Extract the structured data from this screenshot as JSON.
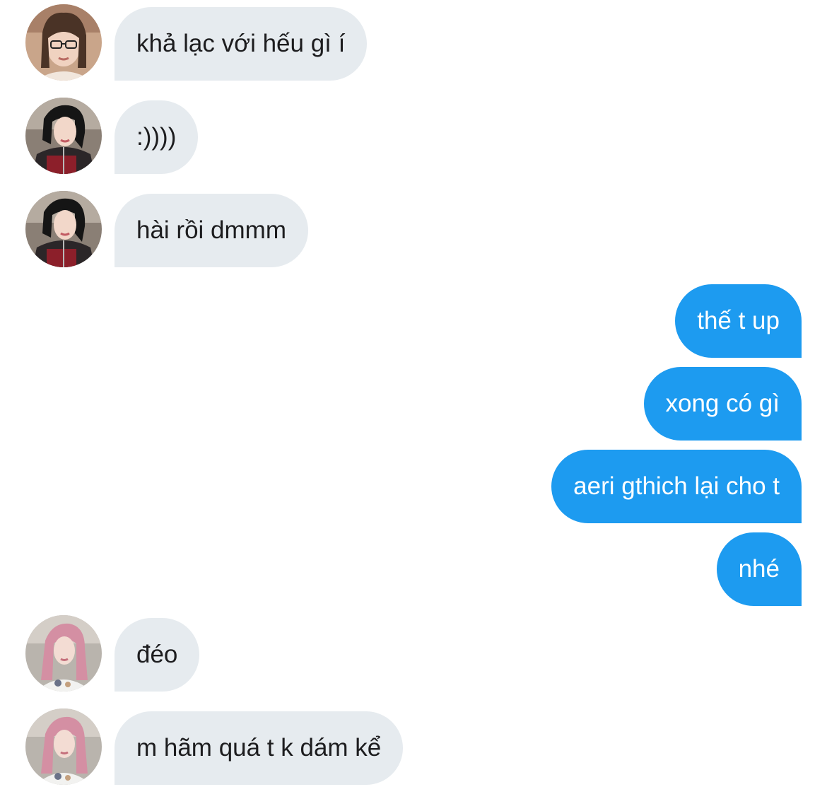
{
  "colors": {
    "incoming_bubble": "#e6ebef",
    "outgoing_bubble": "#1d9bf0",
    "incoming_text": "#1d1d1f",
    "outgoing_text": "#ffffff"
  },
  "messages": [
    {
      "side": "in",
      "avatar": "profile-photo-glasses",
      "text": "khả lạc với hếu gì í"
    },
    {
      "side": "in",
      "avatar": "profile-photo-black-hair",
      "text": ":))))"
    },
    {
      "side": "in",
      "avatar": "profile-photo-black-hair",
      "text": "hài rồi dmmm"
    },
    {
      "side": "out",
      "text": "thế t up"
    },
    {
      "side": "out",
      "text": "xong có gì"
    },
    {
      "side": "out",
      "text": "aeri gthich lại cho t"
    },
    {
      "side": "out",
      "text": "nhé"
    },
    {
      "side": "in",
      "avatar": "profile-photo-pink-hair",
      "text": "đéo"
    },
    {
      "side": "in",
      "avatar": "profile-photo-pink-hair",
      "text": "m hãm quá t k dám kể"
    }
  ]
}
